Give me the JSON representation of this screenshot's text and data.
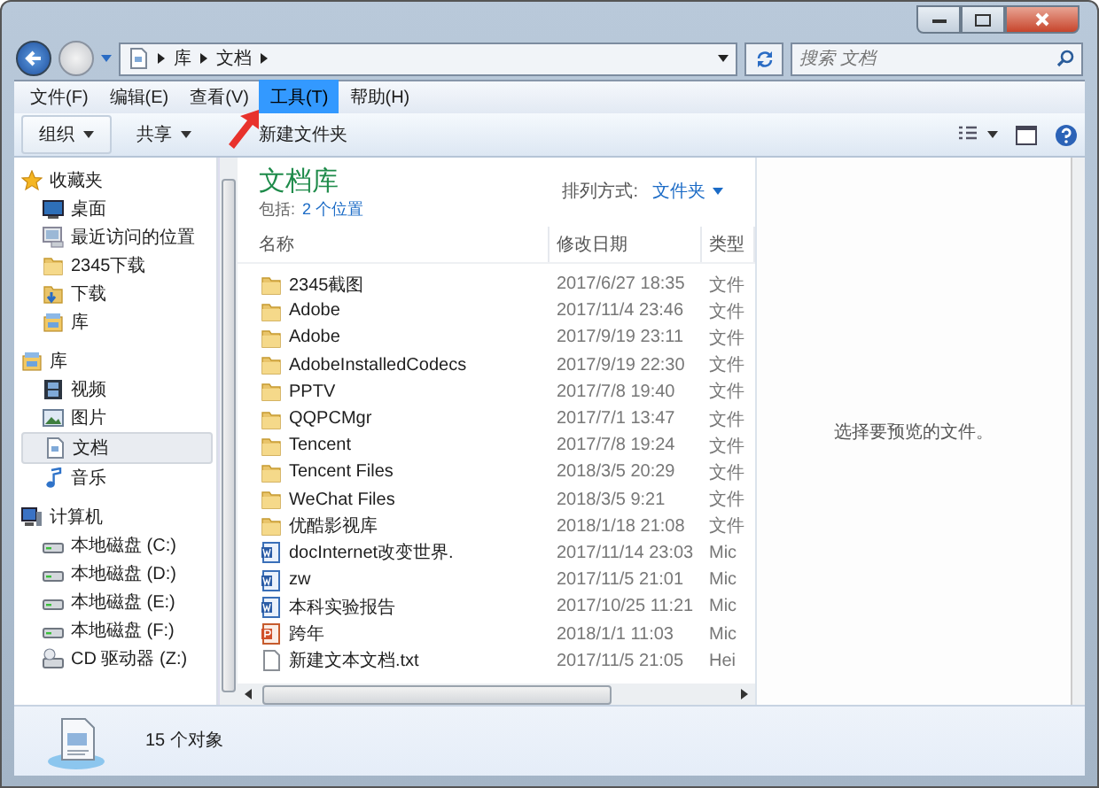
{
  "address": {
    "path": [
      "库",
      "文档"
    ],
    "search_placeholder": "搜索 文档"
  },
  "menu": [
    {
      "label": "文件(F)",
      "selected": false
    },
    {
      "label": "编辑(E)",
      "selected": false
    },
    {
      "label": "查看(V)",
      "selected": false
    },
    {
      "label": "工具(T)",
      "selected": true
    },
    {
      "label": "帮助(H)",
      "selected": false
    }
  ],
  "toolbar": [
    {
      "label": "组织",
      "has_menu": true
    },
    {
      "label": "共享",
      "has_menu": true
    },
    {
      "label": "新建文件夹",
      "has_menu": false
    }
  ],
  "nav": [
    {
      "label": "收藏夹",
      "kind": "star",
      "children": [
        {
          "label": "桌面",
          "kind": "desktop",
          "selected": false
        },
        {
          "label": "最近访问的位置",
          "kind": "recent",
          "selected": false
        },
        {
          "label": "2345下载",
          "kind": "folder",
          "selected": false
        },
        {
          "label": "下载",
          "kind": "download",
          "selected": false
        },
        {
          "label": "库",
          "kind": "library",
          "selected": false
        }
      ]
    },
    {
      "label": "库",
      "kind": "library",
      "children": [
        {
          "label": "视频",
          "kind": "video",
          "selected": false
        },
        {
          "label": "图片",
          "kind": "picture",
          "selected": false
        },
        {
          "label": "文档",
          "kind": "document",
          "selected": true
        },
        {
          "label": "音乐",
          "kind": "music",
          "selected": false
        }
      ]
    },
    {
      "label": "计算机",
      "kind": "computer",
      "children": [
        {
          "label": "本地磁盘 (C:)",
          "kind": "drive",
          "selected": false
        },
        {
          "label": "本地磁盘 (D:)",
          "kind": "drive",
          "selected": false
        },
        {
          "label": "本地磁盘 (E:)",
          "kind": "drive",
          "selected": false
        },
        {
          "label": "本地磁盘 (F:)",
          "kind": "drive",
          "selected": false
        },
        {
          "label": "CD 驱动器 (Z:)",
          "kind": "cd",
          "selected": false
        }
      ]
    }
  ],
  "library": {
    "title": "文档库",
    "includes_label": "包括:",
    "includes_link": "2 个位置",
    "sort_label": "排列方式:",
    "sort_value": "文件夹"
  },
  "table": {
    "columns": [
      "名称",
      "修改日期",
      "类型"
    ],
    "rows": [
      {
        "kind": "folder",
        "name": "2345截图",
        "date": "2017/6/27 18:35",
        "type": "文件"
      },
      {
        "kind": "folder",
        "name": "Adobe",
        "date": "2017/11/4 23:46",
        "type": "文件"
      },
      {
        "kind": "folder",
        "name": "Adobe",
        "date": "2017/9/19 23:11",
        "type": "文件"
      },
      {
        "kind": "folder",
        "name": "AdobeInstalledCodecs",
        "date": "2017/9/19 22:30",
        "type": "文件"
      },
      {
        "kind": "folder",
        "name": "PPTV",
        "date": "2017/7/8 19:40",
        "type": "文件"
      },
      {
        "kind": "folder",
        "name": "QQPCMgr",
        "date": "2017/7/1 13:47",
        "type": "文件"
      },
      {
        "kind": "folder",
        "name": "Tencent",
        "date": "2017/7/8 19:24",
        "type": "文件"
      },
      {
        "kind": "folder",
        "name": "Tencent Files",
        "date": "2018/3/5 20:29",
        "type": "文件"
      },
      {
        "kind": "folder",
        "name": "WeChat Files",
        "date": "2018/3/5 9:21",
        "type": "文件"
      },
      {
        "kind": "folder",
        "name": "优酷影视库",
        "date": "2018/1/18 21:08",
        "type": "文件"
      },
      {
        "kind": "word",
        "name": "docInternet改变世界.",
        "date": "2017/11/14 23:03",
        "type": "Mic"
      },
      {
        "kind": "word",
        "name": "zw",
        "date": "2017/11/5 21:01",
        "type": "Mic"
      },
      {
        "kind": "word",
        "name": "本科实验报告",
        "date": "2017/10/25 11:21",
        "type": "Mic"
      },
      {
        "kind": "ppt",
        "name": "跨年",
        "date": "2018/1/1 11:03",
        "type": "Mic"
      },
      {
        "kind": "text",
        "name": "新建文本文档.txt",
        "date": "2017/11/5 21:05",
        "type": "Hei"
      }
    ]
  },
  "preview": {
    "message": "选择要预览的文件。"
  },
  "status": {
    "count": "15 个对象"
  },
  "annotation": {
    "kind": "arrow"
  }
}
